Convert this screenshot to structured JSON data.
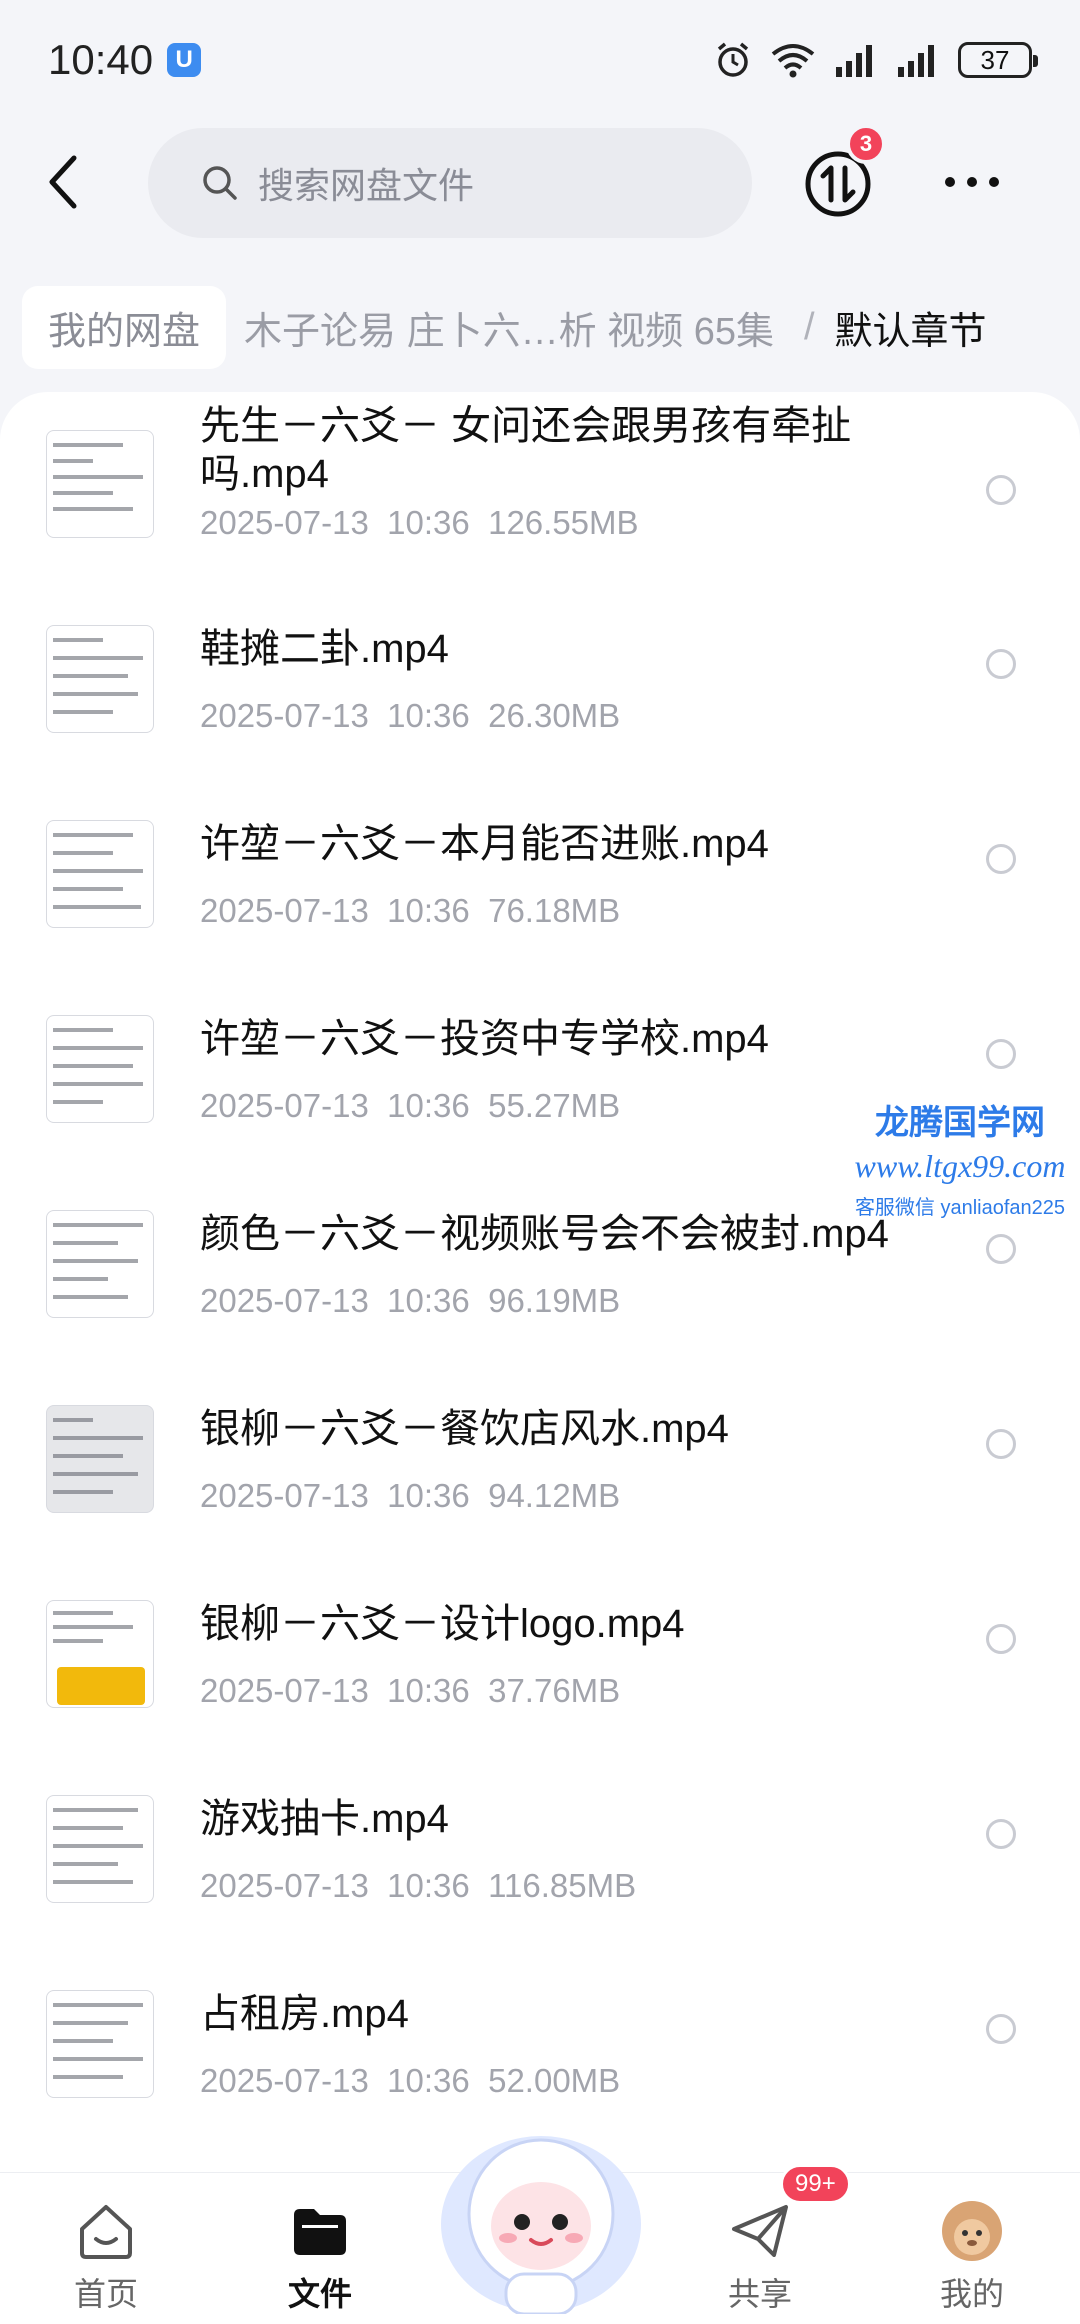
{
  "status_bar": {
    "time": "10:40",
    "app_badge": "U",
    "battery": "37"
  },
  "header": {
    "search_placeholder": "搜索网盘文件",
    "transfer_badge": "3"
  },
  "breadcrumb": {
    "home": "我的网盘",
    "folder": "木子论易 庄卜六…析 视频 65集",
    "separator": "/",
    "current": "默认章节"
  },
  "files": [
    {
      "name": "先生－六爻－ 女问还会跟男孩有牵扯吗.mp4",
      "date": "2025-07-13",
      "time": "10:36",
      "size": "126.55MB"
    },
    {
      "name": "鞋摊二卦.mp4",
      "date": "2025-07-13",
      "time": "10:36",
      "size": "26.30MB"
    },
    {
      "name": "许堃－六爻－本月能否进账.mp4",
      "date": "2025-07-13",
      "time": "10:36",
      "size": "76.18MB"
    },
    {
      "name": "许堃－六爻－投资中专学校.mp4",
      "date": "2025-07-13",
      "time": "10:36",
      "size": "55.27MB"
    },
    {
      "name": "颜色－六爻－视频账号会不会被封.mp4",
      "date": "2025-07-13",
      "time": "10:36",
      "size": "96.19MB"
    },
    {
      "name": "银柳－六爻－餐饮店风水.mp4",
      "date": "2025-07-13",
      "time": "10:36",
      "size": "94.12MB"
    },
    {
      "name": "银柳－六爻－设计logo.mp4",
      "date": "2025-07-13",
      "time": "10:36",
      "size": "37.76MB"
    },
    {
      "name": "游戏抽卡.mp4",
      "date": "2025-07-13",
      "time": "10:36",
      "size": "116.85MB"
    },
    {
      "name": "占租房.mp4",
      "date": "2025-07-13",
      "time": "10:36",
      "size": "52.00MB"
    }
  ],
  "watermark": {
    "title": "龙腾国学网",
    "url": "www.ltgx99.com",
    "contact": "客服微信 yanliaofan225"
  },
  "bottom_nav": {
    "home": "首页",
    "files": "文件",
    "share": "共享",
    "share_badge": "99+",
    "mine": "我的"
  },
  "colors": {
    "accent": "#2d7be8",
    "badge": "#f2435a",
    "background": "#f4f5f9"
  }
}
